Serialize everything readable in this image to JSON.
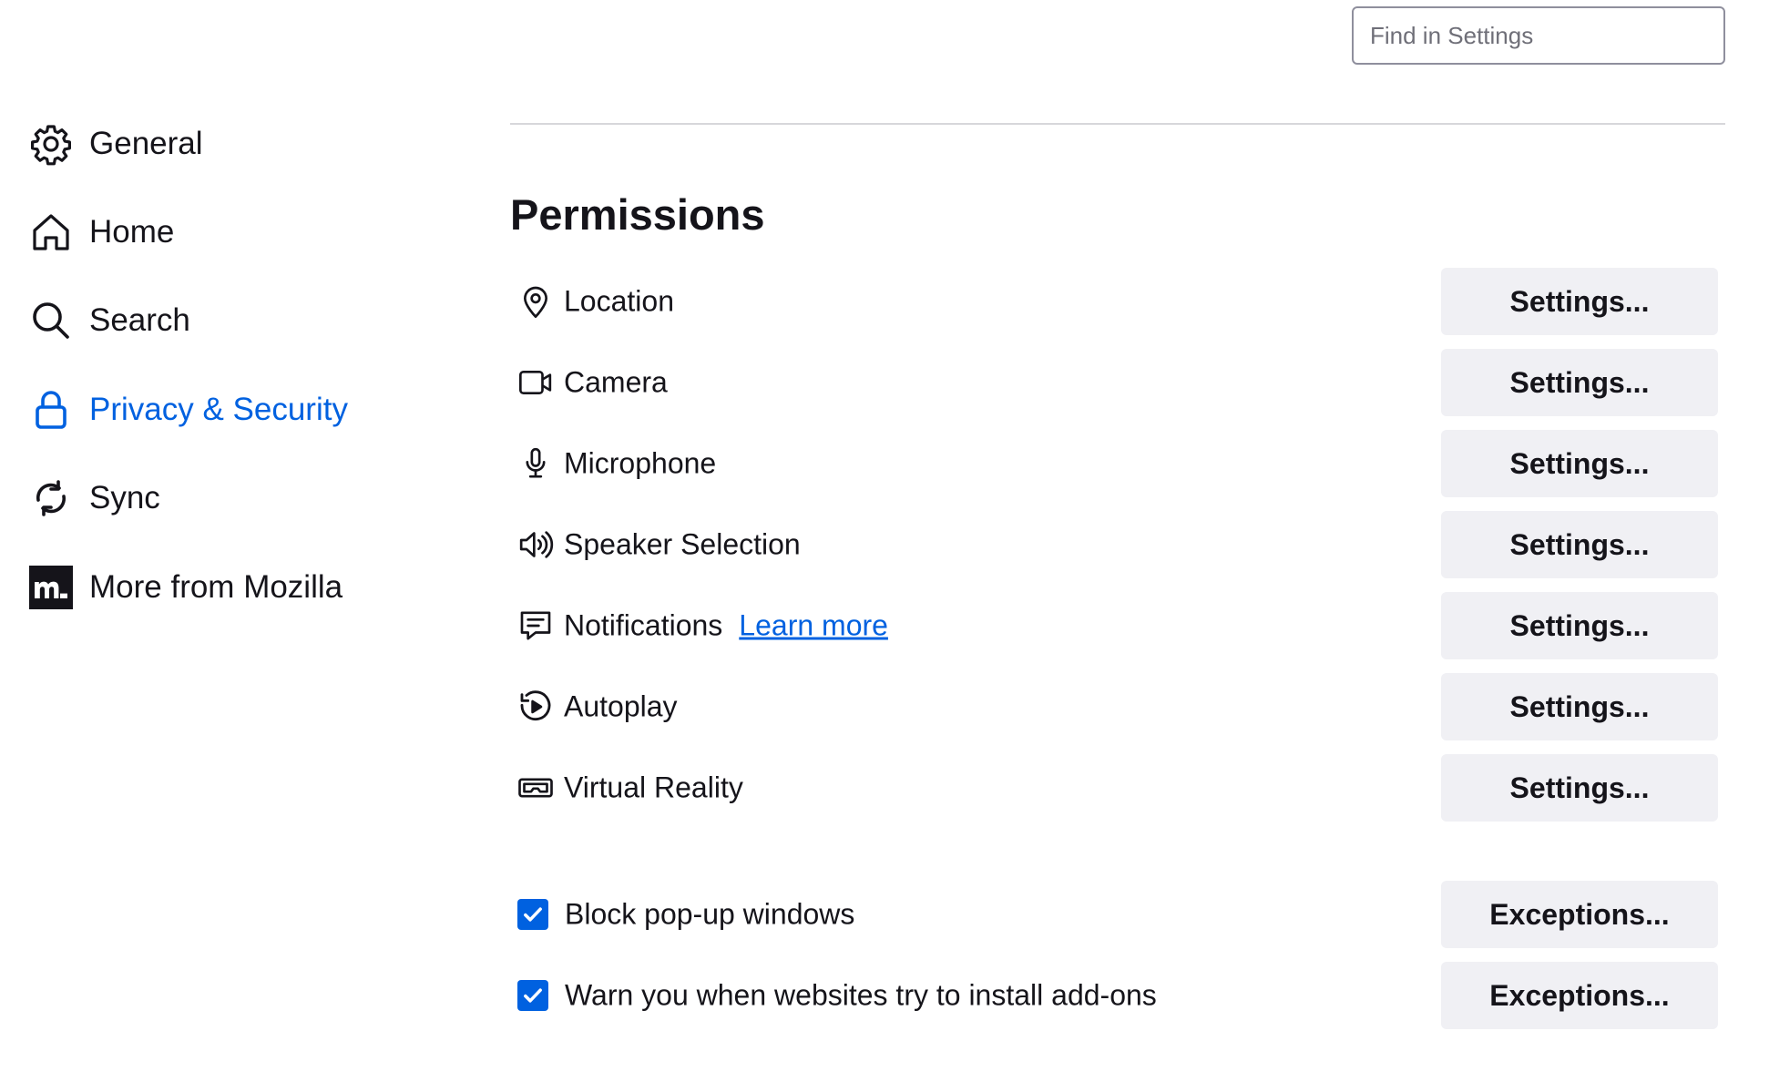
{
  "search": {
    "placeholder": "Find in Settings"
  },
  "sidebar": {
    "items": [
      {
        "label": "General",
        "icon": "gear-icon"
      },
      {
        "label": "Home",
        "icon": "home-icon"
      },
      {
        "label": "Search",
        "icon": "search-icon"
      },
      {
        "label": "Privacy & Security",
        "icon": "lock-icon",
        "active": true
      },
      {
        "label": "Sync",
        "icon": "sync-icon"
      },
      {
        "label": "More from Mozilla",
        "icon": "mozilla-icon"
      }
    ]
  },
  "permissions": {
    "title": "Permissions",
    "rows": [
      {
        "label": "Location",
        "icon": "location-icon",
        "button": "Settings..."
      },
      {
        "label": "Camera",
        "icon": "camera-icon",
        "button": "Settings..."
      },
      {
        "label": "Microphone",
        "icon": "microphone-icon",
        "button": "Settings..."
      },
      {
        "label": "Speaker Selection",
        "icon": "speaker-icon",
        "button": "Settings..."
      },
      {
        "label": "Notifications",
        "icon": "notification-icon",
        "link": "Learn more",
        "button": "Settings..."
      },
      {
        "label": "Autoplay",
        "icon": "autoplay-icon",
        "button": "Settings..."
      },
      {
        "label": "Virtual Reality",
        "icon": "vr-headset-icon",
        "button": "Settings..."
      }
    ],
    "checks": [
      {
        "label": "Block pop-up windows",
        "checked": true,
        "button": "Exceptions..."
      },
      {
        "label": "Warn you when websites try to install add-ons",
        "checked": true,
        "button": "Exceptions..."
      }
    ]
  },
  "colors": {
    "accent": "#0061e0",
    "button_bg": "#f0f0f4",
    "divider": "#d7d7db"
  }
}
